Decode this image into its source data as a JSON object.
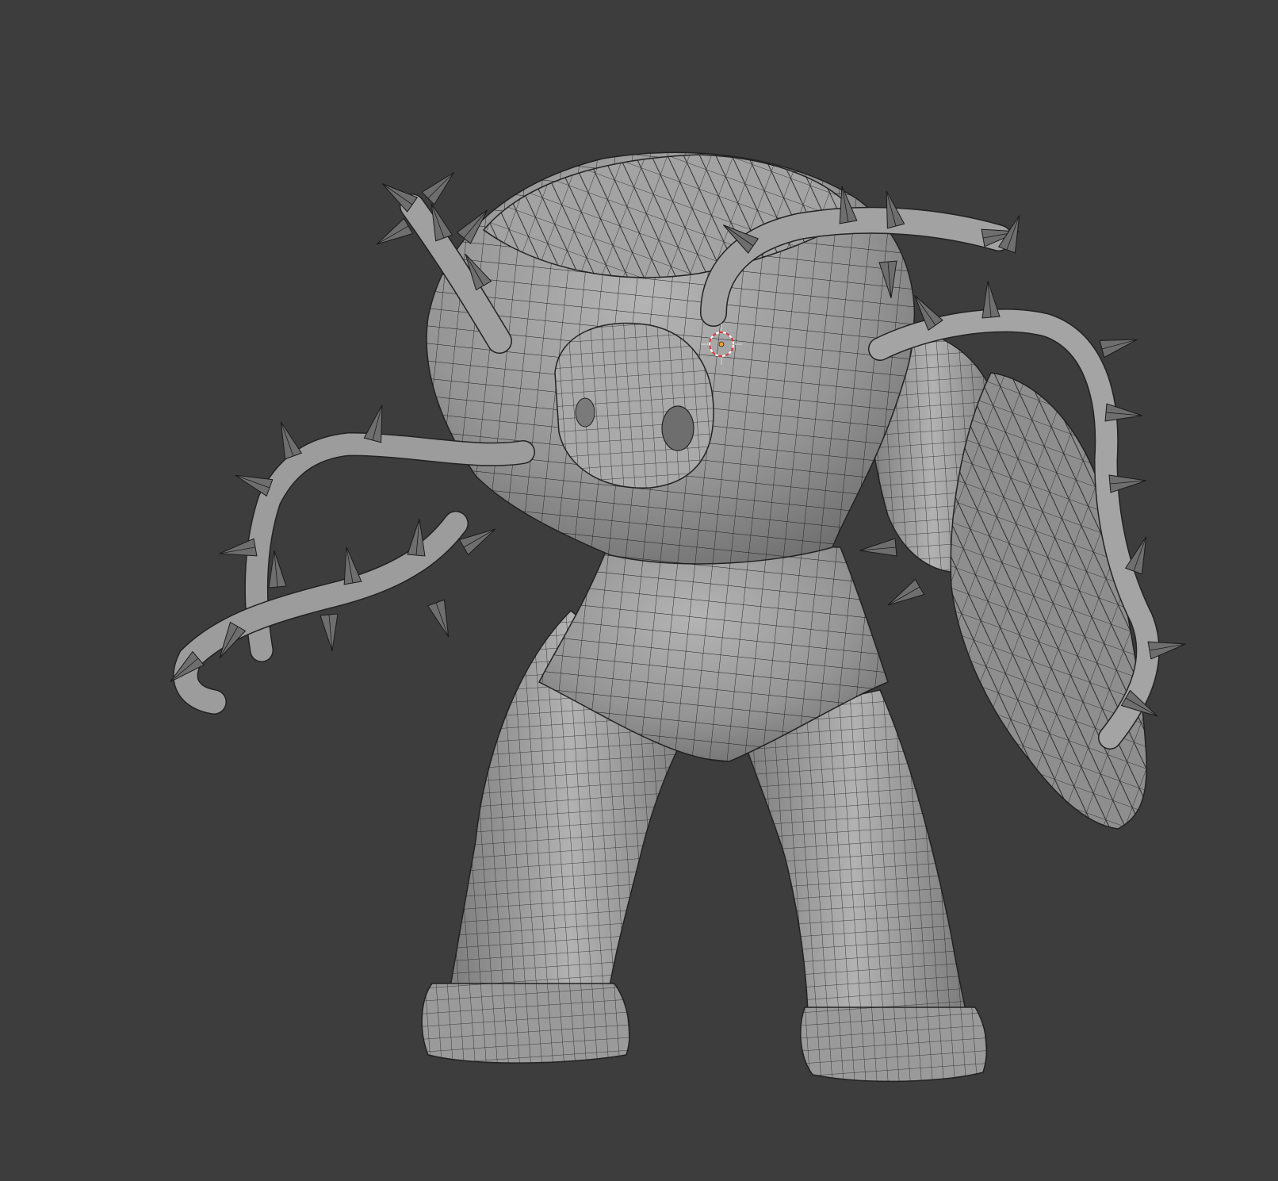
{
  "viewport": {
    "type": "3d-viewport",
    "shading": "solid",
    "overlay": "wireframe",
    "background_color": "#3d3d3d",
    "mesh_color": "#8f8f8f",
    "wire_color": "#1a1a1a"
  },
  "scene": {
    "object": "thorn-golem-mesh",
    "cursor": "3d-cursor-icon"
  }
}
